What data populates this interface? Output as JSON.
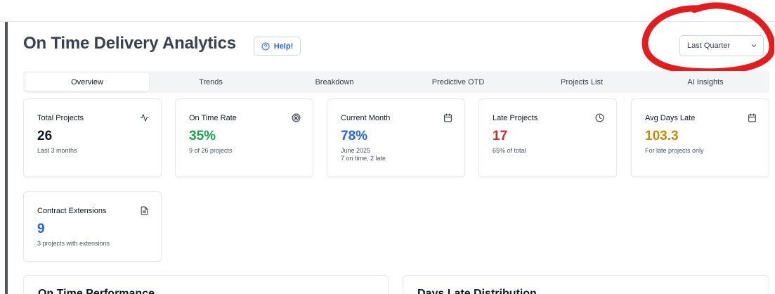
{
  "header": {
    "title": "On Time Delivery Analytics",
    "help_label": "Help!",
    "period_select": "Last Quarter"
  },
  "tabs": [
    {
      "label": "Overview"
    },
    {
      "label": "Trends"
    },
    {
      "label": "Breakdown"
    },
    {
      "label": "Predictive OTD"
    },
    {
      "label": "Projects List"
    },
    {
      "label": "AI Insights"
    }
  ],
  "cards": [
    {
      "title": "Total Projects",
      "value": "26",
      "sub": "Last 3 months",
      "sub2": "",
      "icon": "activity-icon",
      "color": "#111827"
    },
    {
      "title": "On Time Rate",
      "value": "35%",
      "sub": "9 of 26 projects",
      "sub2": "",
      "icon": "target-icon",
      "color": "#16a34a"
    },
    {
      "title": "Current Month",
      "value": "78%",
      "sub": "June 2025",
      "sub2": "7 on time, 2 late",
      "icon": "calendar-icon",
      "color": "#2563eb"
    },
    {
      "title": "Late Projects",
      "value": "17",
      "sub": "65% of total",
      "sub2": "",
      "icon": "clock-icon",
      "color": "#dc2626"
    },
    {
      "title": "Avg Days Late",
      "value": "103.3",
      "sub": "For late projects only",
      "sub2": "",
      "icon": "calendar-icon",
      "color": "#ca8a04"
    },
    {
      "title": "Contract Extensions",
      "value": "9",
      "sub": "3 projects with extensions",
      "sub2": "",
      "icon": "document-icon",
      "color": "#2563eb"
    }
  ],
  "panels": [
    {
      "title": "On Time Performance"
    },
    {
      "title": "Days Late Distribution"
    }
  ],
  "colors": {
    "accent": "#2563eb",
    "annotation": "#e11d1d"
  }
}
